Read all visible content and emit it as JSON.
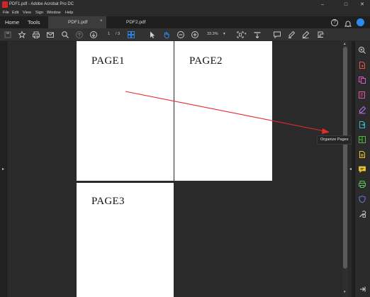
{
  "window": {
    "title": "PDF1.pdf - Adobe Acrobat Pro DC",
    "controls": [
      "–",
      "□",
      "✕"
    ]
  },
  "menu": [
    "File",
    "Edit",
    "View",
    "Sign",
    "Window",
    "Help"
  ],
  "nav": {
    "home": "Home",
    "tools": "Tools"
  },
  "tabs": [
    {
      "label": "PDF1.pdf",
      "close": "×",
      "active": true
    },
    {
      "label": "PDF2.pdf",
      "active": false
    }
  ],
  "toolbar": {
    "page_current": "1",
    "page_total": "/ 3",
    "zoom": "33.3%",
    "zoom_caret": "▾"
  },
  "pages": [
    "PAGE1",
    "PAGE2",
    "PAGE3"
  ],
  "tooltip": "Organize Pages",
  "colors": {
    "accent_blue": "#2d8ceb",
    "annotation_arrow": "#e32b2b"
  }
}
